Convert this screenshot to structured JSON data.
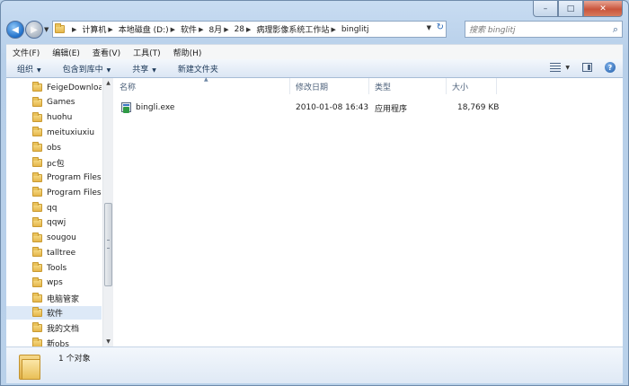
{
  "window": {
    "minimize_glyph": "–",
    "maximize_glyph": "□",
    "close_glyph": "✕"
  },
  "address": {
    "crumbs": [
      "计算机",
      "本地磁盘 (D:)",
      "软件",
      "8月",
      "28",
      "病理影像系统工作站",
      "binglitj"
    ]
  },
  "search": {
    "placeholder": "搜索 binglitj"
  },
  "menu": [
    "文件(F)",
    "编辑(E)",
    "查看(V)",
    "工具(T)",
    "帮助(H)"
  ],
  "toolbar": {
    "organize": "组织",
    "include_library": "包含到库中",
    "share": "共享",
    "new_folder": "新建文件夹"
  },
  "nav": {
    "items": [
      "FeigeDownloa",
      "Games",
      "huohu",
      "meituxiuxiu",
      "obs",
      "pc包",
      "Program Files",
      "Program Files",
      "qq",
      "qqwj",
      "sougou",
      "talltree",
      "Tools",
      "wps",
      "电脑管家",
      "软件",
      "我的文档",
      "新obs"
    ],
    "selected": "软件"
  },
  "columns": {
    "name": "名称",
    "modified": "修改日期",
    "type": "类型",
    "size": "大小"
  },
  "files": [
    {
      "name": "bingli.exe",
      "modified": "2010-01-08 16:43",
      "type": "应用程序",
      "size": "18,769 KB",
      "icon": "exe-icon"
    }
  ],
  "details": {
    "status": "1 个对象"
  }
}
